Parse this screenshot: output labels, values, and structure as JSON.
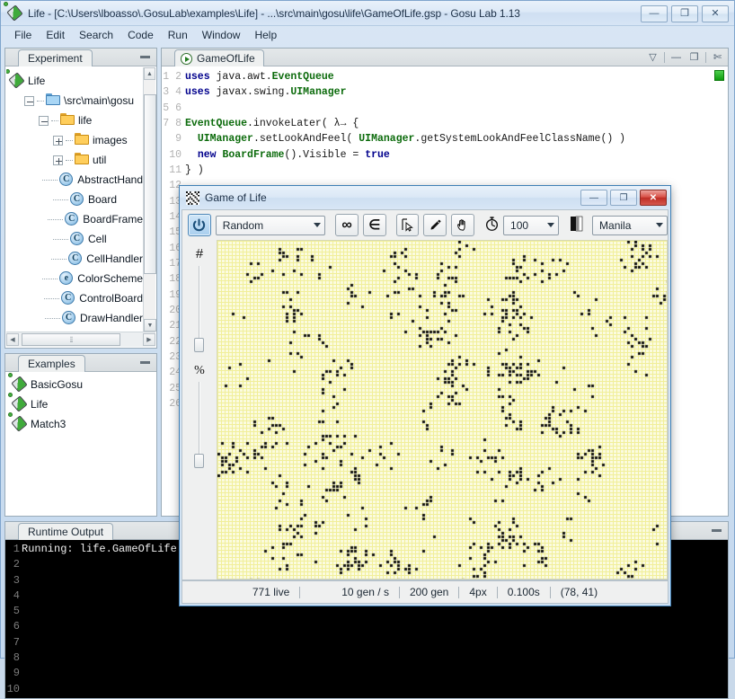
{
  "window": {
    "title": "Life - [C:\\Users\\lboasso\\.GosuLab\\examples\\Life] - ...\\src\\main\\gosu\\life\\GameOfLife.gsp - Gosu Lab 1.13",
    "icon": "flask-icon",
    "buttons": {
      "minimize": "—",
      "maximize": "❐",
      "close": "✕"
    }
  },
  "menubar": {
    "items": [
      "File",
      "Edit",
      "Search",
      "Code",
      "Run",
      "Window",
      "Help"
    ]
  },
  "experiment": {
    "tab_label": "Experiment",
    "tree": [
      {
        "label": "Life",
        "icon": "flask-icon",
        "depth": 0,
        "expander": "none"
      },
      {
        "label": "\\src\\main\\gosu",
        "icon": "folder-blue-icon",
        "depth": 1,
        "expander": "minus"
      },
      {
        "label": "life",
        "icon": "folder-icon",
        "depth": 2,
        "expander": "minus"
      },
      {
        "label": "images",
        "icon": "folder-icon",
        "depth": 3,
        "expander": "plus"
      },
      {
        "label": "util",
        "icon": "folder-icon",
        "depth": 3,
        "expander": "plus"
      },
      {
        "label": "AbstractHand",
        "icon": "class-icon",
        "depth": 3,
        "expander": "leaf",
        "badge": "C"
      },
      {
        "label": "Board",
        "icon": "class-icon",
        "depth": 3,
        "expander": "leaf",
        "badge": "C"
      },
      {
        "label": "BoardFrame",
        "icon": "class-icon",
        "depth": 3,
        "expander": "leaf",
        "badge": "C"
      },
      {
        "label": "Cell",
        "icon": "class-icon",
        "depth": 3,
        "expander": "leaf",
        "badge": "C"
      },
      {
        "label": "CellHandler",
        "icon": "class-icon",
        "depth": 3,
        "expander": "leaf",
        "badge": "C"
      },
      {
        "label": "ColorScheme",
        "icon": "enum-icon",
        "depth": 3,
        "expander": "leaf",
        "badge": "e"
      },
      {
        "label": "ControlBoard",
        "icon": "class-icon",
        "depth": 3,
        "expander": "leaf",
        "badge": "C"
      },
      {
        "label": "DrawHandler",
        "icon": "class-icon",
        "depth": 3,
        "expander": "leaf",
        "badge": "C"
      }
    ]
  },
  "examples": {
    "tab_label": "Examples",
    "items": [
      {
        "label": "BasicGosu",
        "icon": "flask-icon"
      },
      {
        "label": "Life",
        "icon": "flask-icon"
      },
      {
        "label": "Match3",
        "icon": "flask-icon"
      }
    ]
  },
  "editor": {
    "tab_label": "GameOfLife",
    "tab_icon": "run-icon",
    "tools": [
      "chevron-down-icon",
      "minimize-icon",
      "maximize-icon",
      "close-icon"
    ],
    "line_numbers": [
      1,
      2,
      3,
      4,
      5,
      6,
      7,
      8,
      9,
      10,
      11,
      12,
      13,
      14,
      15,
      16,
      17,
      18,
      19,
      20,
      21,
      22,
      23,
      24,
      25,
      26
    ],
    "code_lines": [
      "uses java.awt.EventQueue",
      "uses javax.swing.UIManager",
      "",
      "EventQueue.invokeLater( λ→ {",
      "  UIManager.setLookAndFeel( UIManager.getSystemLookAndFeelClassName() )",
      "  new BoardFrame().Visible = true",
      "} )"
    ]
  },
  "runtime": {
    "tab_label": "Runtime Output",
    "line_numbers": [
      1,
      2,
      3,
      4,
      5,
      6,
      7,
      8,
      9,
      10
    ],
    "text": "Running: life.GameOfLife."
  },
  "gol": {
    "title": "Game of Life",
    "icon": "checkerboard-icon",
    "buttons": {
      "minimize": "—",
      "maximize": "❐",
      "close": "✕"
    },
    "toolbar": {
      "power_button": "power-icon",
      "pattern_select": "Random",
      "infinite_button": "infinity-icon",
      "wrap_button": "wrap-icon",
      "select_tool": "pointer-select-icon",
      "draw_tool": "pencil-icon",
      "pan_tool": "hand-icon",
      "speed_icon": "stopwatch-icon",
      "speed_value": "100",
      "palette_icon": "palette-icon",
      "color_scheme": "Manila"
    },
    "sliders": [
      {
        "name": "grid-size-slider",
        "label": "#"
      },
      {
        "name": "density-slider",
        "label": "%"
      }
    ],
    "status": {
      "live": "771 live",
      "rate": "10 gen / s",
      "generation": "200 gen",
      "cellsize": "4px",
      "interval": "0.100s",
      "cursor": "(78, 41)"
    }
  },
  "colors": {
    "grid_background": "#fbfbdf",
    "grid_lines": "#f1ef9a",
    "cell": "#101010",
    "accent": "#3f7fb5",
    "window_chrome": "#d8e6f6"
  }
}
